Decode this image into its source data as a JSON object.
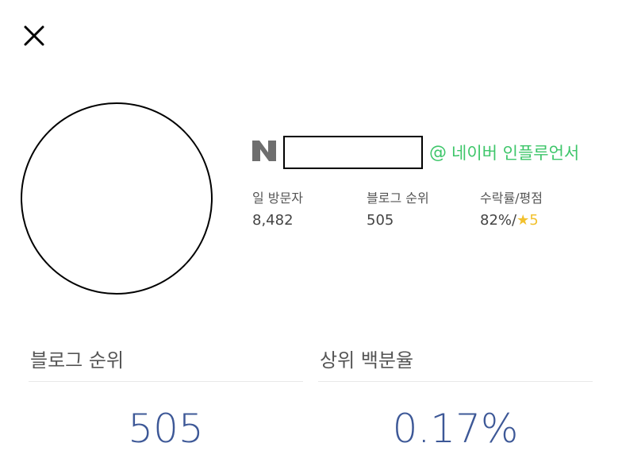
{
  "close": {
    "icon": "close-icon"
  },
  "profile": {
    "avatar_icon": "avatar-placeholder",
    "logo_letter": "N",
    "logo_color": "#6e6e6e",
    "influencer": {
      "at": "@",
      "label": "네이버 인플루언서",
      "color": "#3ec66a"
    }
  },
  "stats": {
    "daily_visitors": {
      "label": "일 방문자",
      "value": "8,482"
    },
    "blog_rank": {
      "label": "블로그 순위",
      "value": "505"
    },
    "acceptance": {
      "label": "수락률/평점",
      "value": "82%/",
      "star": "★",
      "rating": "5"
    }
  },
  "panels": {
    "rank": {
      "title": "블로그 순위",
      "value": "505"
    },
    "percentile": {
      "title": "상위 백분율",
      "value": "0.17%"
    }
  },
  "colors": {
    "accent_blue": "#3d5897",
    "star_yellow": "#f2c12e",
    "divider": "#e8e8e8"
  }
}
